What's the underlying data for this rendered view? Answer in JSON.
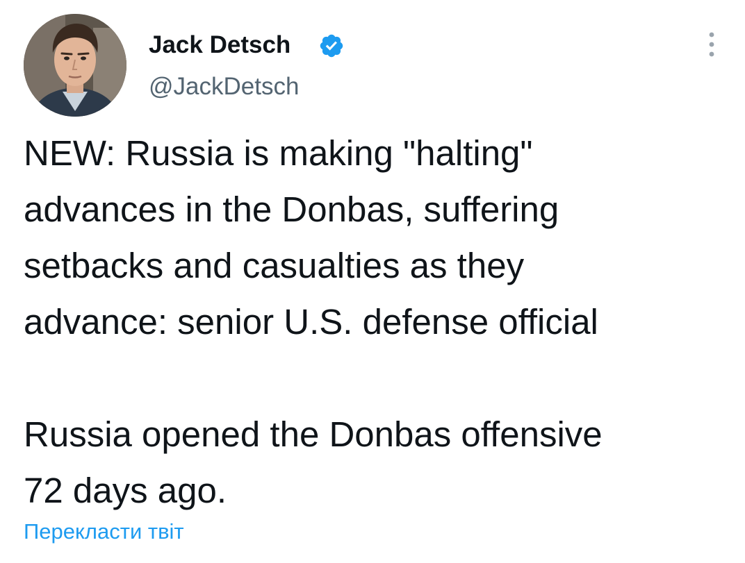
{
  "author": {
    "name": "Jack Detsch",
    "handle": "@JackDetsch",
    "verified": true
  },
  "tweet": {
    "text": "NEW: Russia is making \"halting\"\nadvances in the Donbas, suffering\nsetbacks and casualties as they\nadvance: senior U.S. defense official\n\nRussia opened the Donbas offensive\n72 days ago."
  },
  "actions": {
    "translate_label": "Перекласти твіт"
  },
  "icons": {
    "verified": "verified-badge-icon",
    "more": "more-options-icon"
  },
  "colors": {
    "text": "#0f1419",
    "secondary": "#536471",
    "accent": "#1d9bf0"
  }
}
